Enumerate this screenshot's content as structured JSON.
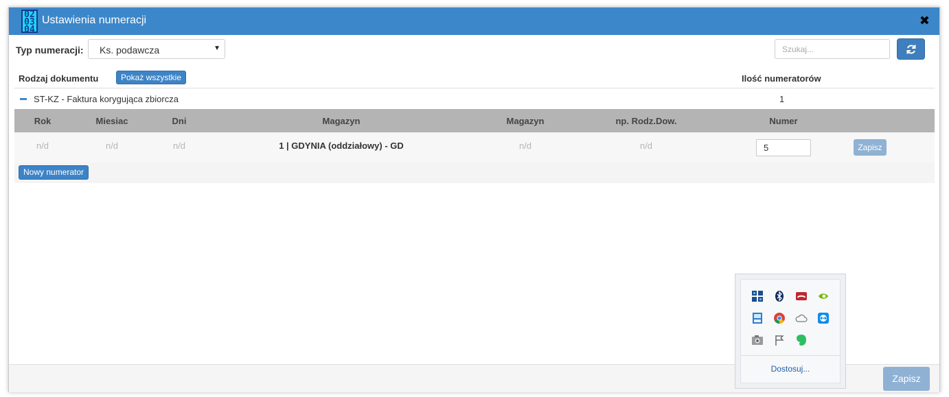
{
  "dialog": {
    "title": "Ustawienia numeracji",
    "icon_glyph_lines": [
      "02",
      "03",
      "04"
    ],
    "close_glyph": "✖"
  },
  "filter": {
    "type_label": "Typ numeracji:",
    "type_value": "Ks. podawcza",
    "search_placeholder": "Szukaj..."
  },
  "list_header": {
    "doc_label": "Rodzaj dokumentu",
    "show_all_label": "Pokaż wszystkie",
    "count_label": "Ilość numeratorów"
  },
  "group": {
    "label": "ST-KZ - Faktura korygująca zbiorcza",
    "count": "1"
  },
  "sub_table": {
    "columns": [
      "Rok",
      "Miesiac",
      "Dni",
      "Magazyn",
      "Magazyn",
      "np. Rodz.Dow.",
      "Numer"
    ],
    "row": {
      "rok": "n/d",
      "miesiac": "n/d",
      "dni": "n/d",
      "magazyn": "1 | GDYNIA (oddziałowy) - GD",
      "magazyn2": "n/d",
      "rodz_dow": "n/d",
      "numer": "5",
      "save_label": "Zapisz"
    },
    "new_label": "Nowy numerator"
  },
  "footer": {
    "save_label": "Zapisz"
  },
  "tray": {
    "icons": [
      "taskview-icon",
      "bluetooth-icon",
      "phone-icon",
      "nvidia-icon",
      "network-drive-icon",
      "chrome-icon",
      "onedrive-icon",
      "teamviewer-icon",
      "camera-icon",
      "flag-icon",
      "evernote-icon"
    ],
    "customize_label": "Dostosuj..."
  },
  "colors": {
    "titlebar": "#3c87c9",
    "primary_button": "#3d83c6",
    "disabled_button": "#8fb1d4",
    "table_header": "#b4b4b4"
  }
}
